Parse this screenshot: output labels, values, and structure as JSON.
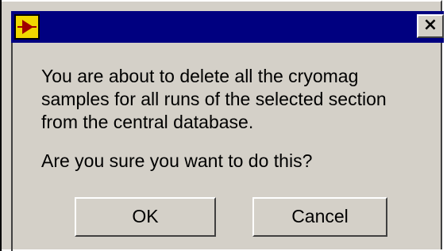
{
  "dialog": {
    "title": "",
    "icon": "labview-vi-icon",
    "close_label": "×",
    "message_lines": [
      "You are about to delete all the cryomag",
      "samples for all runs of the selected section",
      "from the central database."
    ],
    "question": "Are you sure you want to do this?",
    "buttons": {
      "ok_label": "OK",
      "cancel_label": "Cancel"
    }
  }
}
